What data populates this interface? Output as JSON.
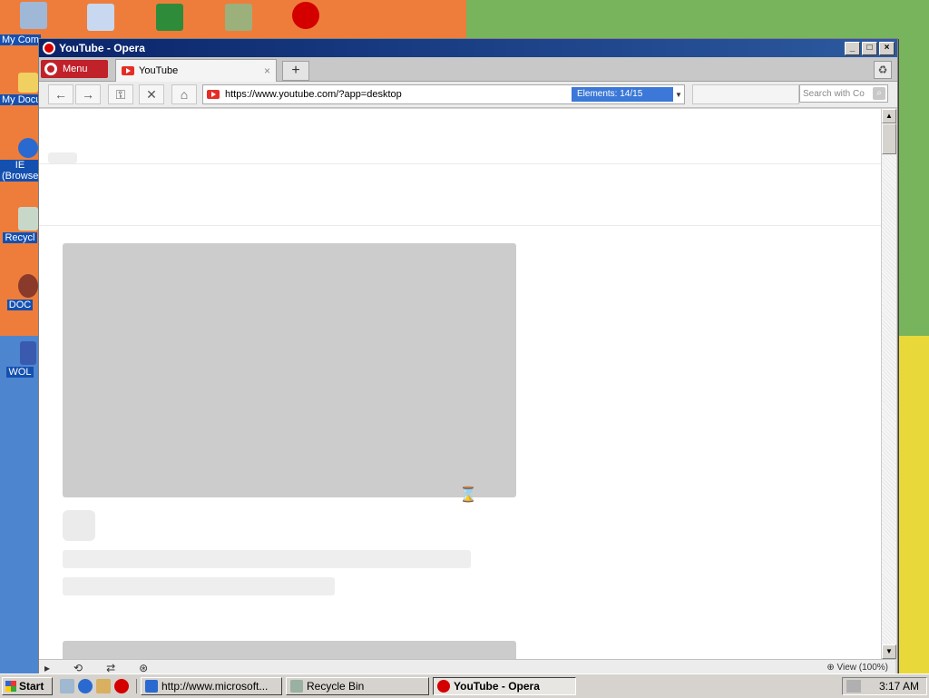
{
  "desktop": {
    "icons": [
      {
        "label": "My Com"
      },
      {
        "label": "My Docu"
      },
      {
        "label": "IE (Browse"
      },
      {
        "label": "Recycl"
      },
      {
        "label": "DOC"
      },
      {
        "label": "WOL"
      }
    ]
  },
  "window": {
    "title": "YouTube - Opera",
    "menu_label": "Menu",
    "tab_title": "YouTube",
    "new_tab_label": "+",
    "close_tab": "×"
  },
  "toolbar": {
    "url": "https://www.youtube.com/?app=desktop",
    "elements_label": "Elements:  14/15",
    "search_placeholder": "Search with Co"
  },
  "statusbar": {
    "view_label": "View (100%)"
  },
  "taskbar": {
    "start_label": "Start",
    "tasks": [
      {
        "label": "http://www.microsoft..."
      },
      {
        "label": "Recycle Bin"
      },
      {
        "label": "YouTube - Opera"
      }
    ],
    "clock": "3:17 AM"
  },
  "colors": {
    "opera_red": "#c0212a",
    "titlebar": "#0a246a",
    "elements_blue": "#3b78d8"
  }
}
